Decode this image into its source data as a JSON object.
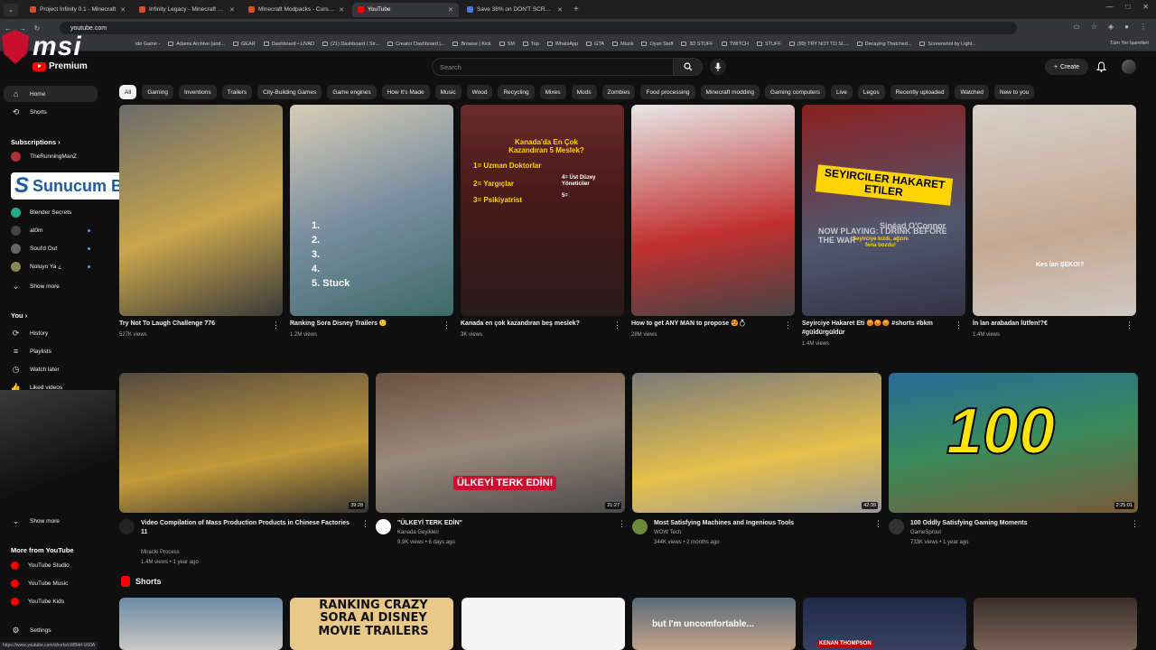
{
  "tabs": [
    {
      "title": "Project Infinity 0.1 - Minecraft",
      "color": "#e24a2e"
    },
    {
      "title": "Infinity Legacy - Minecraft Mod",
      "color": "#e24a2e"
    },
    {
      "title": "Minecraft Modpacks - CurseFor",
      "color": "#e24a2e"
    },
    {
      "title": "YouTube",
      "color": "#ff0000"
    },
    {
      "title": "Save 38% on DON'T SCREAM",
      "color": "#4a7ad9"
    }
  ],
  "url": "youtube.com",
  "bookmarks": [
    "Adams Archive (and...",
    "GEAR",
    "Dashboard • LIVAD",
    "(21) Dashboard / Str...",
    "Creator Dashboard |...",
    "Browse | Kick",
    "SM",
    "Top",
    "WhatsApp",
    "GTA",
    "Müzik",
    "Oyun Stuff",
    "3D STUFF",
    "TWITCH",
    "STUFF",
    "(99) TRY NOT TO SL...",
    "Decaying Thatched...",
    "Screenshot by Light..."
  ],
  "bookmarks_all": "Tüm Yer İşaretleri",
  "bookmark_partial": "ide Game -",
  "overlay": {
    "msi_text": "msi",
    "promo_s": "S",
    "promo_text": "Sunucum Burada"
  },
  "header": {
    "logo_suffix": "Premium",
    "search_placeholder": "Search",
    "create_label": "Create"
  },
  "sidebar": {
    "home": "Home",
    "shorts": "Shorts",
    "subscriptions_title": "Subscriptions",
    "subs": [
      {
        "name": "TheRunningManZ",
        "color": "#a33"
      },
      {
        "name": "Blender Secrets",
        "color": "#2a8"
      },
      {
        "name": "at0m",
        "color": "#444"
      },
      {
        "name": "Soul'd Out",
        "color": "#666"
      },
      {
        "name": "Noluyo Ya ¿",
        "color": "#885"
      }
    ],
    "show_more": "Show more",
    "show_more2": "Show more",
    "you_title": "You",
    "you_items": [
      "History",
      "Playlists",
      "Watch later",
      "Liked videos"
    ],
    "more_title": "More from YouTube",
    "more_items": [
      "YouTube Studio",
      "YouTube Music",
      "YouTube Kids"
    ],
    "settings": "Settings"
  },
  "chips": [
    "All",
    "Gaming",
    "Inventions",
    "Trailers",
    "City-Building Games",
    "Game engines",
    "How It's Made",
    "Music",
    "Wood",
    "Recycling",
    "Mixes",
    "Mods",
    "Zombies",
    "Food processing",
    "Minecraft modding",
    "Gaming computers",
    "Live",
    "Legos",
    "Recently uploaded",
    "Watched",
    "New to you"
  ],
  "shorts_row": [
    {
      "title": "Try Not To Laugh Challenge 776",
      "views": "527K views"
    },
    {
      "title": "Ranking Sora Disney Trailers 🙂",
      "views": "1.2M views",
      "overlay": "1.\n2.\n3.\n4.\n5. Stuck"
    },
    {
      "title": "Kanada en çok kazandıran beş meslek?",
      "views": "3K views",
      "overlay_title": "Kanada'da En Çok Kazandıran 5 Meslek?",
      "overlay_items": [
        "1= Uzman Doktorlar",
        "2= Yargıçlar",
        "3= Psikiyatrist",
        "4= Üst Düzey Yöneticiler",
        "5="
      ]
    },
    {
      "title": "How to get ANY MAN to propose 😍💍",
      "views": "28M views"
    },
    {
      "title": "Seyirciye Hakaret Eti 😡😡😡 #shorts #bkm #güldürgüldür",
      "views": "1.4M views",
      "overlay": "SEYIRCILER HAKARET ETILER",
      "overlay2": "Seyirciye kızdı, ağzını fena bozdu!",
      "overlay3": "NOW PLAYING: I DRINK BEFORE THE WAR",
      "overlay4": "Sinéad O'Connor"
    },
    {
      "title": "İn lan arabadan lütfen!?€",
      "views": "1.4M views",
      "overlay": "Kes lan ŞEKO!?"
    }
  ],
  "videos": [
    {
      "title": "Video Compilation of Mass Production Products in Chinese Factories 11",
      "channel": "Miracle Process",
      "views": "1.4M views",
      "age": "1 year ago",
      "duration": "39:28"
    },
    {
      "title": "\"ÜLKEYİ TERK EDİN\"",
      "channel": "Kanada Geyikleri",
      "views": "9.9K views",
      "age": "6 days ago",
      "duration": "21:27",
      "overlay": "ÜLKEYİ TERK EDİN!"
    },
    {
      "title": "Most Satisfying Machines and Ingenious Tools",
      "channel": "WOW Tech",
      "views": "344K views",
      "age": "2 months ago",
      "duration": "42:39"
    },
    {
      "title": "100 Oddly Satisfying Gaming Moments",
      "channel": "GameSprout",
      "views": "733K views",
      "age": "1 year ago",
      "duration": "2:25:01",
      "overlay": "100"
    }
  ],
  "shorts_section": {
    "title": "Shorts",
    "thumb2": "RANKING CRAZY SORA AI DISNEY MOVIE TRAILERS",
    "thumb4": "but I'm uncomfortable...",
    "thumb5": "KENAN THOMPSON"
  },
  "status_url": "https://www.youtube.com/shorts/cWB4rl-U60A"
}
